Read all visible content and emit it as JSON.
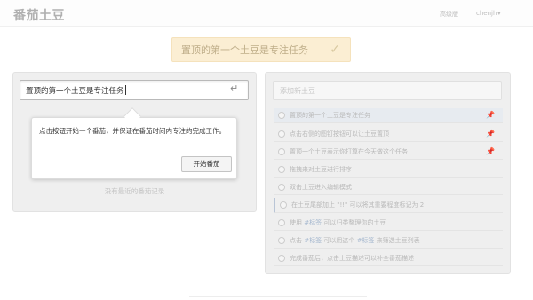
{
  "header": {
    "app_title": "番茄土豆",
    "premium_link": "高级版",
    "username": "chenjh",
    "user_caret": "▾"
  },
  "current_task": {
    "text": "置顶的第一个土豆是专注任务",
    "check_glyph": "✓"
  },
  "left": {
    "input_value": "置顶的第一个土豆是专注任务",
    "enter_glyph": "↵",
    "tooltip_text": "点击按钮开始一个番茄，并保证在番茄时间内专注的完成工作。",
    "start_button": "开始番茄",
    "empty_history": "没有最近的番茄记录"
  },
  "right": {
    "add_placeholder": "添加新土豆",
    "todos": [
      {
        "text": "置顶的第一个土豆是专注任务",
        "pinned": true
      },
      {
        "text": "点击右侧的图钉按钮可以让土豆置顶",
        "pinned": true
      },
      {
        "text": "置顶一个土豆表示你打算在今天做这个任务",
        "pinned": true
      },
      {
        "text": "拖拽来对土豆进行排序",
        "pinned": false
      },
      {
        "text": "双击土豆进入编辑模式",
        "pinned": false
      },
      {
        "text": "在土豆尾部加上 \"!!\" 可以将其重要程度标记为 2",
        "pinned": false
      },
      {
        "pre": "使用 ",
        "tag": "#标签",
        "post": " 可以归类整理你的土豆"
      },
      {
        "pre": "点击 ",
        "tag": "#标签",
        "mid": " 可以用这个 ",
        "tag2": "#标签",
        "post": " 来筛选土豆列表"
      },
      {
        "text": "完成番茄后，点击土豆描述可以补全番茄描述",
        "pinned": false
      }
    ]
  },
  "colors": {
    "banner_bg": "#fbeed3",
    "pin": "#e98aa0",
    "tag": "#a6b8cf"
  },
  "icons": {
    "check": "check-icon",
    "enter": "enter-key-icon",
    "pin": "pin-icon"
  }
}
